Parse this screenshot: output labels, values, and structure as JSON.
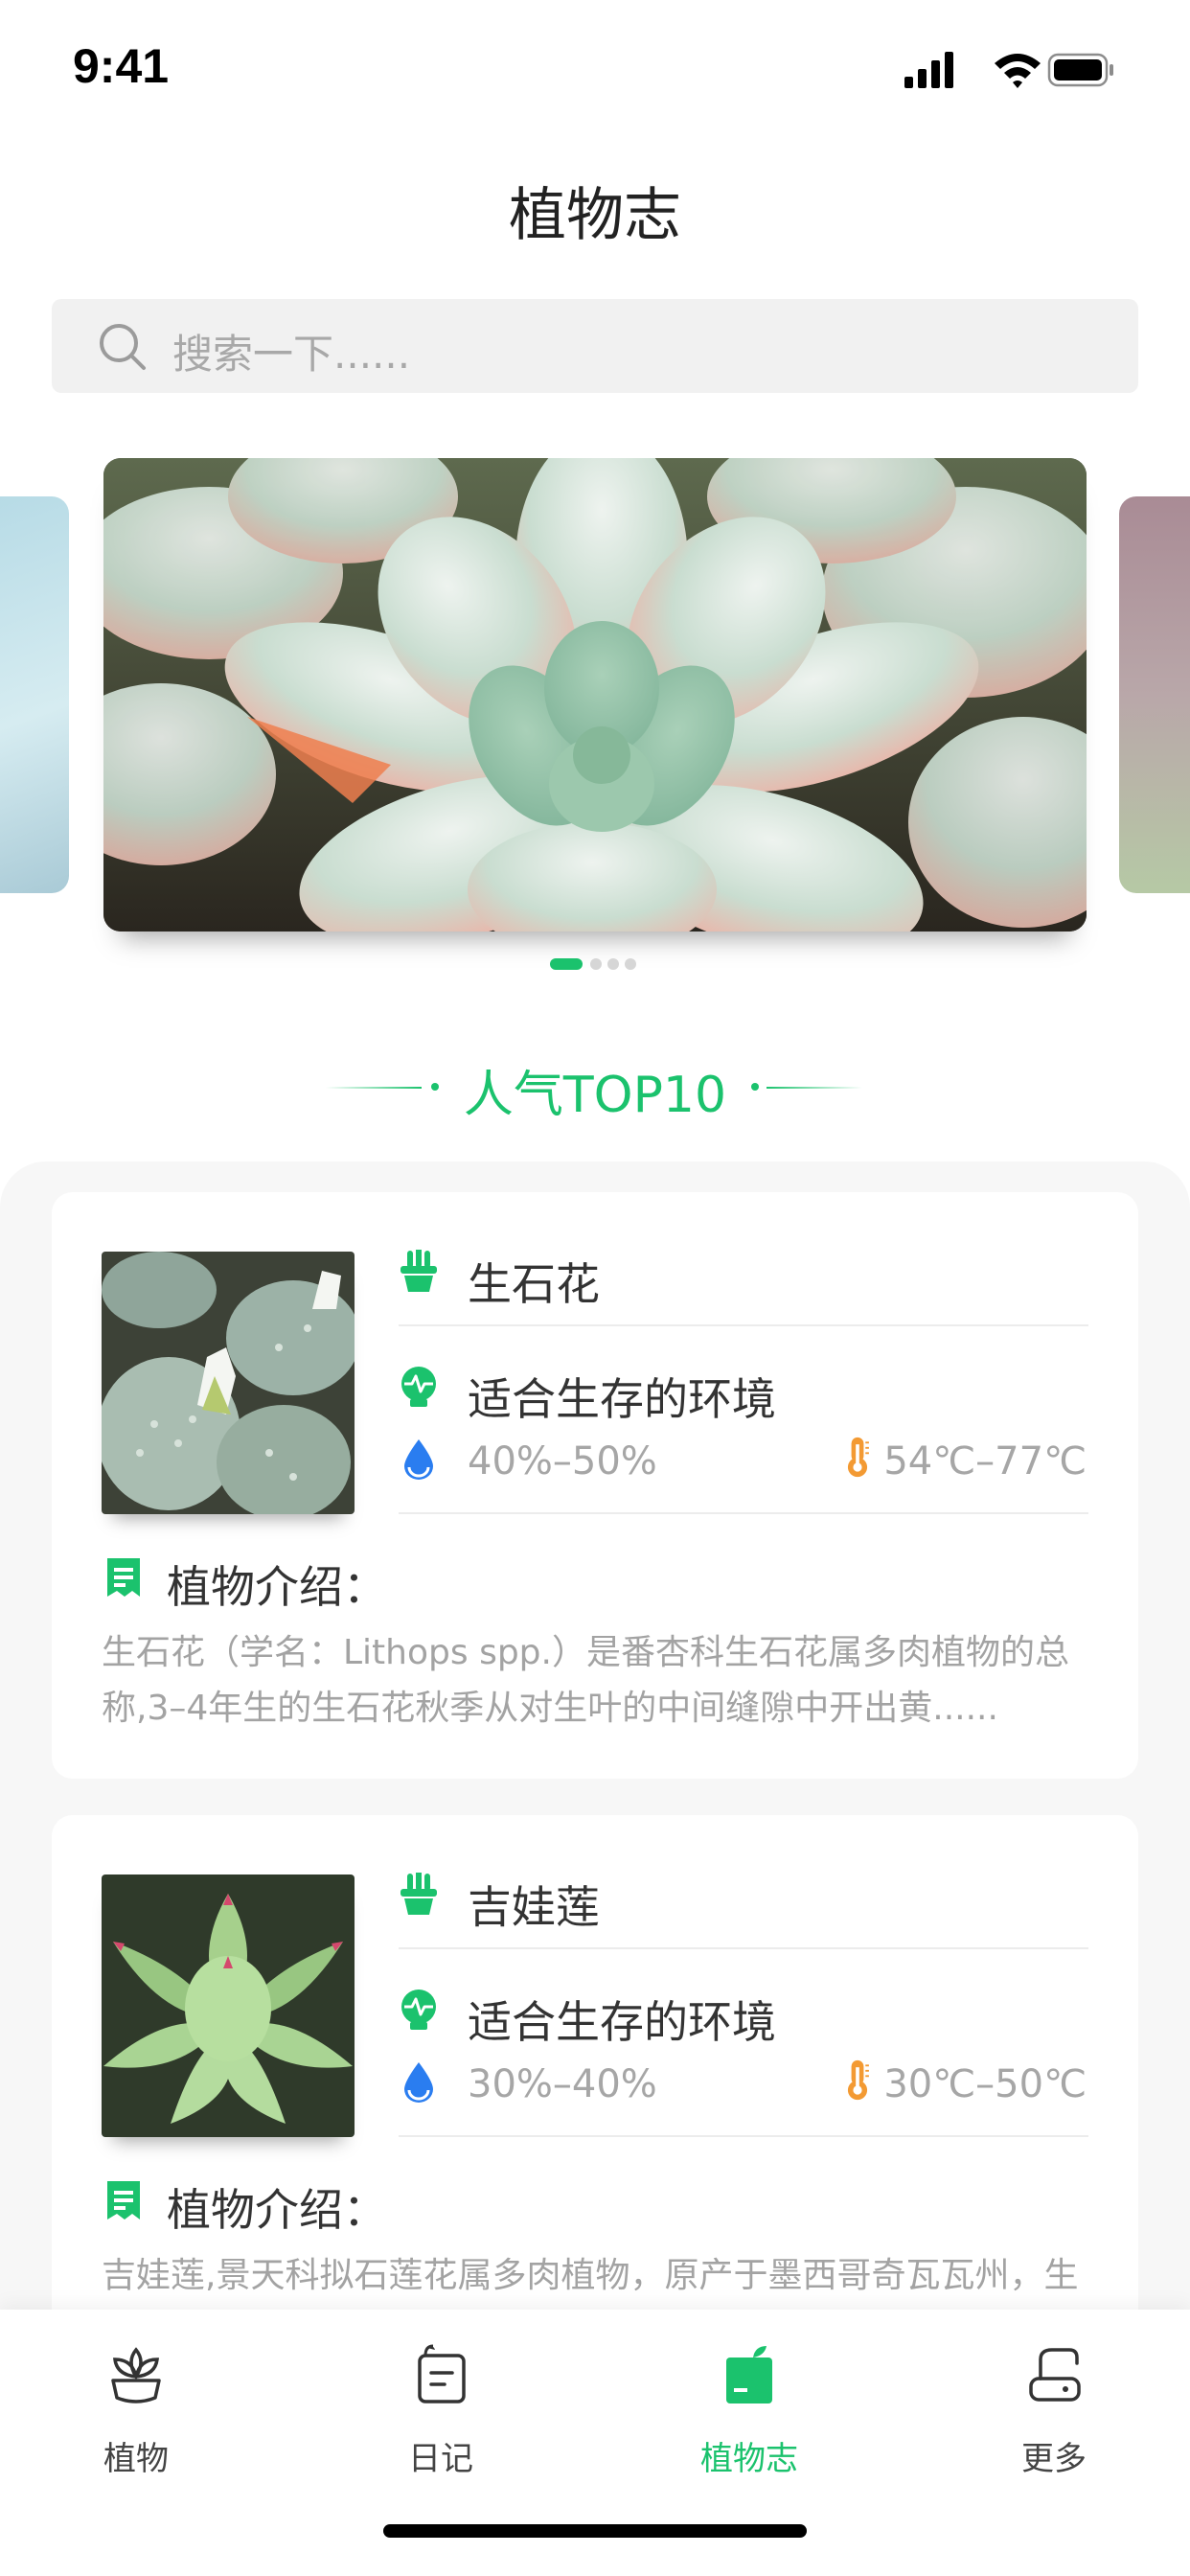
{
  "status_bar": {
    "time": "9:41"
  },
  "header": {
    "title": "植物志"
  },
  "search": {
    "placeholder": "搜索一下......"
  },
  "carousel": {
    "active_index": 0,
    "dot_count": 4
  },
  "section": {
    "heading": "人气TOP10"
  },
  "plants": [
    {
      "name": "生石花",
      "env_title": "适合生存的环境",
      "humidity": "40%–50%",
      "temperature": "54℃–77℃",
      "intro_title": "植物介绍：",
      "intro_text": "生石花（学名：Lithops spp.）是番杏科生石花属多肉植物的总称,3–4年生的生石花秋季从对生叶的中间缝隙中开出黄......"
    },
    {
      "name": "吉娃莲",
      "env_title": "适合生存的环境",
      "humidity": "30%–40%",
      "temperature": "30℃–50℃",
      "intro_title": "植物介绍：",
      "intro_text": "吉娃莲,景天科拟石莲花属多肉植物，原产于墨西哥奇瓦瓦州，生"
    }
  ],
  "tab_bar": {
    "tabs": [
      {
        "label": "植物",
        "icon": "plant-icon",
        "active": false
      },
      {
        "label": "日记",
        "icon": "diary-icon",
        "active": false
      },
      {
        "label": "植物志",
        "icon": "encyclopedia-icon",
        "active": true
      },
      {
        "label": "更多",
        "icon": "more-icon",
        "active": false
      }
    ]
  },
  "colors": {
    "accent": "#1bc26d",
    "water": "#2a7df0",
    "thermo": "#f39a33",
    "text_primary": "#333333",
    "text_secondary": "#a6a6a6"
  }
}
